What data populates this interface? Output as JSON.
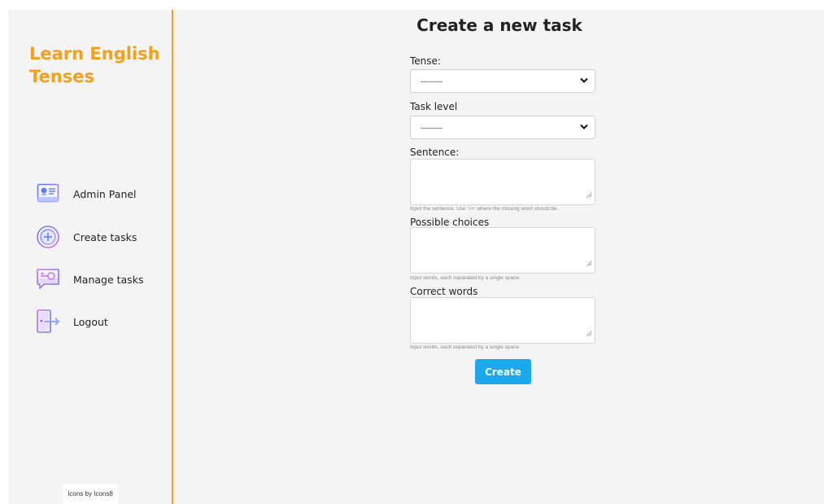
{
  "brand": {
    "title": "Learn English Tenses"
  },
  "sidebar": {
    "items": [
      {
        "label": "Admin Panel",
        "icon": "admin-panel-icon"
      },
      {
        "label": "Create tasks",
        "icon": "plus-circle-icon"
      },
      {
        "label": "Manage tasks",
        "icon": "manage-tasks-icon"
      },
      {
        "label": "Logout",
        "icon": "logout-door-icon"
      }
    ],
    "credit": "Icons by Icons8"
  },
  "main": {
    "title": "Create a new task",
    "form": {
      "tense": {
        "label": "Tense:",
        "value": "---------"
      },
      "task_level": {
        "label": "Task level",
        "value": "---------"
      },
      "sentence": {
        "label": "Sentence:",
        "value": "",
        "help": "Input the sentence. Use '<>' where the missing word should be."
      },
      "possible_choices": {
        "label": "Possible choices",
        "value": "",
        "help": "Input words, each separated by a single space"
      },
      "correct_words": {
        "label": "Correct words",
        "value": "",
        "help": "Input words, each separated by a single space"
      },
      "submit_label": "Create"
    }
  },
  "colors": {
    "accent": "#f5a01a",
    "button": "#1ba8ec",
    "background": "#f4f4f4"
  }
}
